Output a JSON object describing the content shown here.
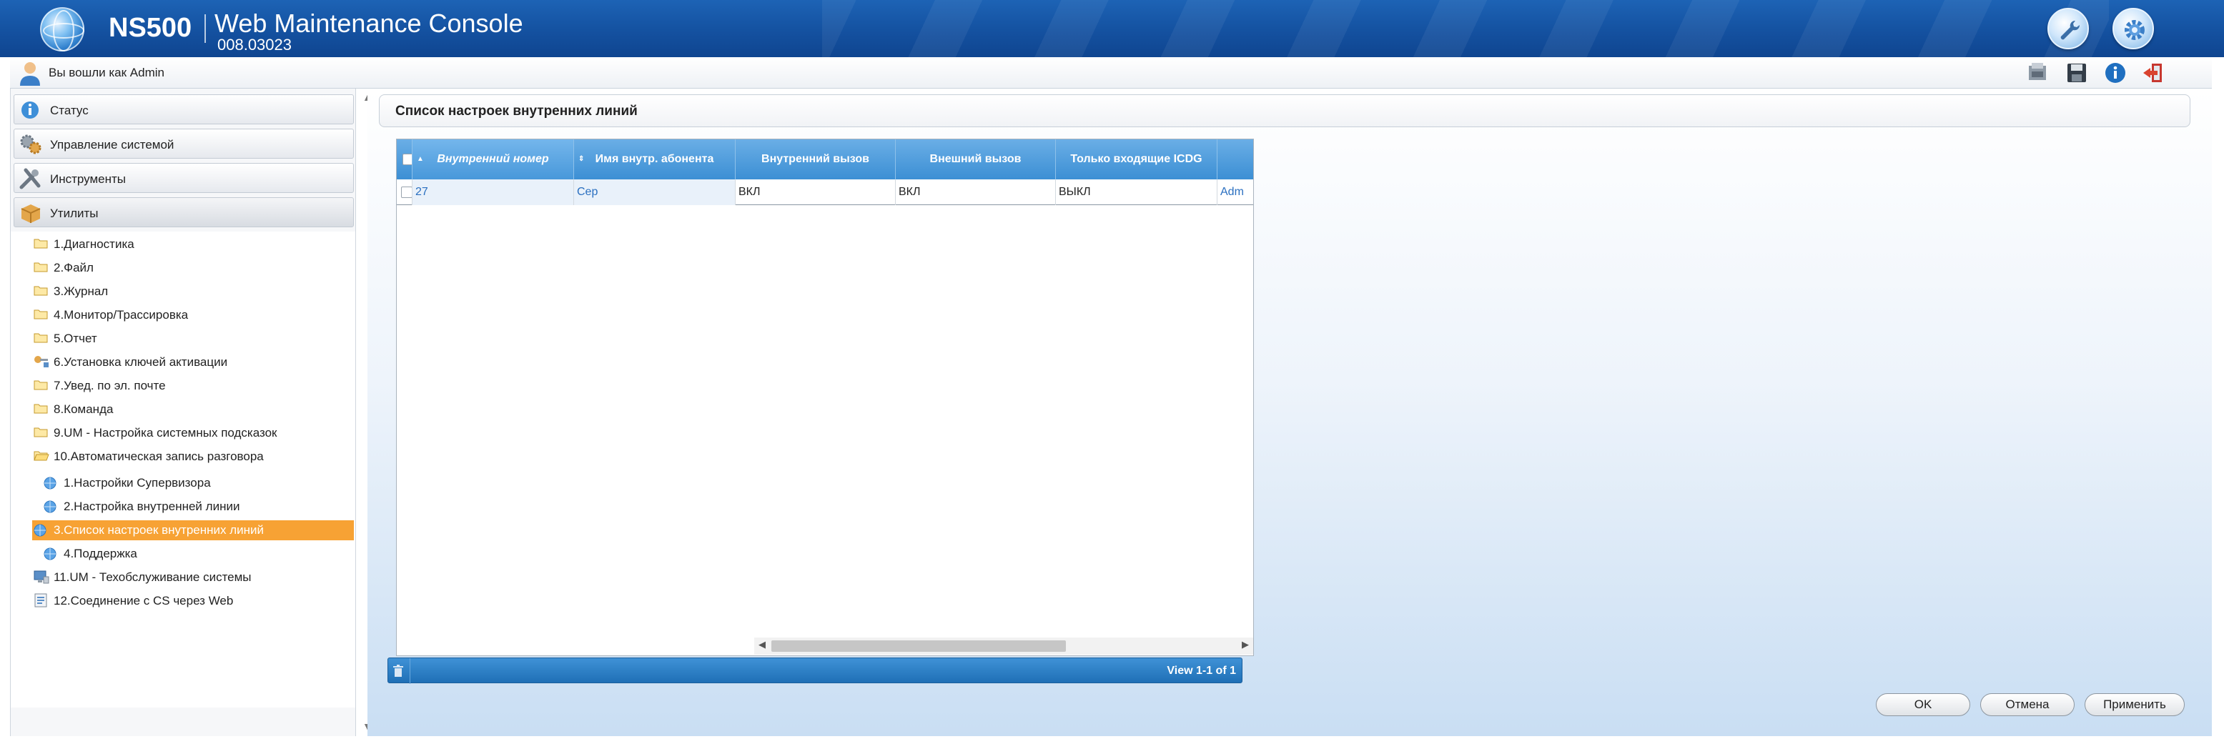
{
  "header": {
    "product": "NS500",
    "title": "Web Maintenance Console",
    "version": "008.03023"
  },
  "userbar": {
    "logged_in_text": "Вы вошли как Admin"
  },
  "sidebar": {
    "sections": [
      {
        "label": "Статус",
        "icon": "info-icon"
      },
      {
        "label": "Управление системой",
        "icon": "gears-icon"
      },
      {
        "label": "Инструменты",
        "icon": "tools-icon"
      },
      {
        "label": "Утилиты",
        "icon": "box-icon"
      }
    ],
    "tree": [
      {
        "label": "1.Диагностика",
        "icon": "folder-icon"
      },
      {
        "label": "2.Файл",
        "icon": "folder-icon"
      },
      {
        "label": "3.Журнал",
        "icon": "folder-icon"
      },
      {
        "label": "4.Монитор/Трассировка",
        "icon": "folder-icon"
      },
      {
        "label": "5.Отчет",
        "icon": "folder-icon"
      },
      {
        "label": "6.Установка ключей активации",
        "icon": "key-icon"
      },
      {
        "label": "7.Увед. по эл. почте",
        "icon": "folder-icon"
      },
      {
        "label": "8.Команда",
        "icon": "folder-icon"
      },
      {
        "label": "9.UM - Настройка системных подсказок",
        "icon": "folder-icon"
      },
      {
        "label": "10.Автоматическая запись разговора",
        "icon": "folder-open-icon"
      }
    ],
    "sub_items": [
      {
        "label": "1.Настройки Супервизора",
        "icon": "globe-bullet-icon"
      },
      {
        "label": "2.Настройка внутренней линии",
        "icon": "globe-bullet-icon"
      },
      {
        "label": "3.Список настроек внутренних линий",
        "icon": "globe-bullet-icon",
        "selected": true
      },
      {
        "label": "4.Поддержка",
        "icon": "globe-bullet-icon"
      }
    ],
    "tree_tail": [
      {
        "label": "11.UM - Техобслуживание системы",
        "icon": "monitor-icon"
      },
      {
        "label": "12.Соединение с CS через Web",
        "icon": "document-icon"
      }
    ]
  },
  "main": {
    "page_title": "Список настроек внутренних линий",
    "grid": {
      "columns": [
        "Внутренний номер",
        "Имя внутр. абонента",
        "Внутренний вызов",
        "Внешний вызов",
        "Только входящие ICDG"
      ],
      "rows": [
        {
          "ext": "27",
          "name": "Сер",
          "internal": "ВКЛ",
          "external": "ВКЛ",
          "icdg": "ВЫКЛ",
          "extra": "Adm"
        }
      ]
    },
    "pager_text": "View 1-1 of 1",
    "buttons": {
      "ok": "OK",
      "cancel": "Отмена",
      "apply": "Применить"
    }
  },
  "colors": {
    "banner": "#1451a0",
    "grid_header": "#3c8fd4",
    "selected": "#f7a234"
  }
}
